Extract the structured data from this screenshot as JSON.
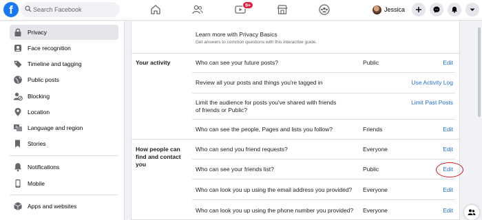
{
  "header": {
    "logo": "f",
    "search_placeholder": "Search Facebook",
    "watch_badge": "9+",
    "profile_name": "Jessica",
    "nav_icons": [
      "home-icon",
      "friends-icon",
      "watch-icon",
      "marketplace-icon",
      "groups-icon"
    ],
    "action_icons": [
      "plus-icon",
      "messenger-icon",
      "notifications-icon",
      "menu-caret-icon"
    ]
  },
  "sidebar": {
    "items": [
      {
        "label": "Privacy",
        "icon": "lock-icon",
        "active": true
      },
      {
        "label": "Face recognition",
        "icon": "face-recognition-icon"
      },
      {
        "label": "Timeline and tagging",
        "icon": "tag-icon"
      },
      {
        "label": "Public posts",
        "icon": "globe-icon"
      },
      {
        "label": "Blocking",
        "icon": "blocking-icon"
      },
      {
        "label": "Location",
        "icon": "location-icon"
      },
      {
        "label": "Language and region",
        "icon": "language-icon"
      },
      {
        "label": "Stories",
        "icon": "stories-icon"
      },
      {
        "label": "Notifications",
        "icon": "bell-icon"
      },
      {
        "label": "Mobile",
        "icon": "mobile-icon"
      },
      {
        "label": "Apps and websites",
        "icon": "apps-icon"
      }
    ]
  },
  "main": {
    "basics_title": "Learn more with Privacy Basics",
    "basics_subtitle": "Get answers to common questions with this interactive guide.",
    "sections": [
      {
        "title": "Your activity",
        "rows": [
          {
            "question": "Who can see your future posts?",
            "value": "Public",
            "action": "Edit"
          },
          {
            "question": "Review all your posts and things you're tagged in",
            "value": "",
            "action": "Use Activity Log"
          },
          {
            "question": "Limit the audience for posts you've shared with friends of friends or Public?",
            "value": "",
            "action": "Limit Past Posts"
          },
          {
            "question": "Who can see the people, Pages and lists you follow?",
            "value": "Friends",
            "action": "Edit"
          }
        ]
      },
      {
        "title": "How people can find and contact you",
        "rows": [
          {
            "question": "Who can send you friend requests?",
            "value": "Everyone",
            "action": "Edit"
          },
          {
            "question": "Who can see your friends list?",
            "value": "Public",
            "action": "Edit",
            "highlighted": true
          },
          {
            "question": "Who can look you up using the email address you provided?",
            "value": "Everyone",
            "action": "Edit"
          },
          {
            "question": "Who can look you up using the phone number you provided?",
            "value": "Everyone",
            "action": "Edit"
          }
        ]
      }
    ]
  },
  "colors": {
    "brand": "#1877f2",
    "link": "#216fdb",
    "highlight_circle": "#d0121b",
    "badge": "#e41e3f"
  }
}
